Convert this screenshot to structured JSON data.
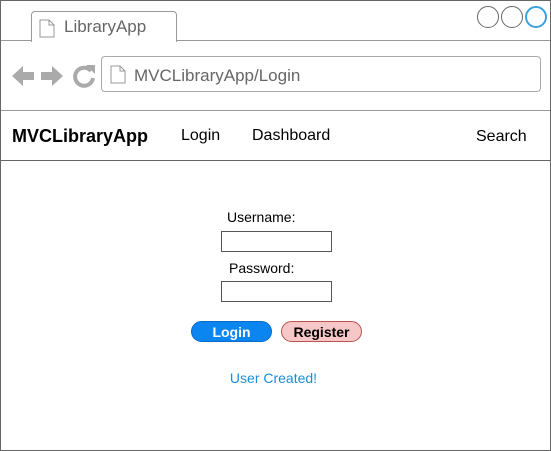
{
  "browser": {
    "tab_title": "LibraryApp",
    "url": "MVCLibraryApp/Login",
    "window_controls": [
      "minimize",
      "maximize",
      "close"
    ]
  },
  "navbar": {
    "brand": "MVCLibraryApp",
    "links": {
      "login": "Login",
      "dashboard": "Dashboard",
      "search": "Search"
    }
  },
  "login_form": {
    "username_label": "Username:",
    "username_value": "",
    "password_label": "Password:",
    "password_value": "",
    "login_button": "Login",
    "register_button": "Register"
  },
  "status": {
    "message": "User Created!",
    "color": "#1b8fd6"
  },
  "colors": {
    "login_button": "#0b85f0",
    "register_button": "#f7c6c6",
    "accent": "#3ba3dc"
  },
  "icons": [
    "page-icon",
    "back-arrow-icon",
    "forward-arrow-icon",
    "reload-icon"
  ]
}
